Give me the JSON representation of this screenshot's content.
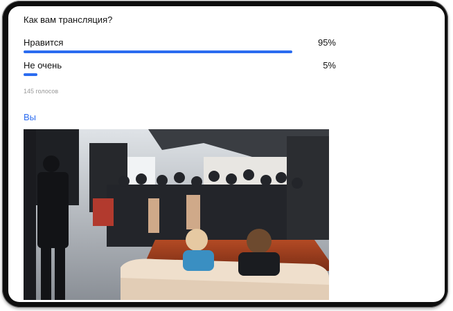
{
  "poll": {
    "question": "Как вам трансляция?",
    "options": [
      {
        "label": "Нравится",
        "percent_text": "95%",
        "percent": 95
      },
      {
        "label": "Не очень",
        "percent_text": "5%",
        "percent": 5
      }
    ],
    "votes_text": "145 голосов"
  },
  "post": {
    "author": "Вы"
  },
  "colors": {
    "accent": "#2b6cf0",
    "device": "#0e0e0e"
  }
}
